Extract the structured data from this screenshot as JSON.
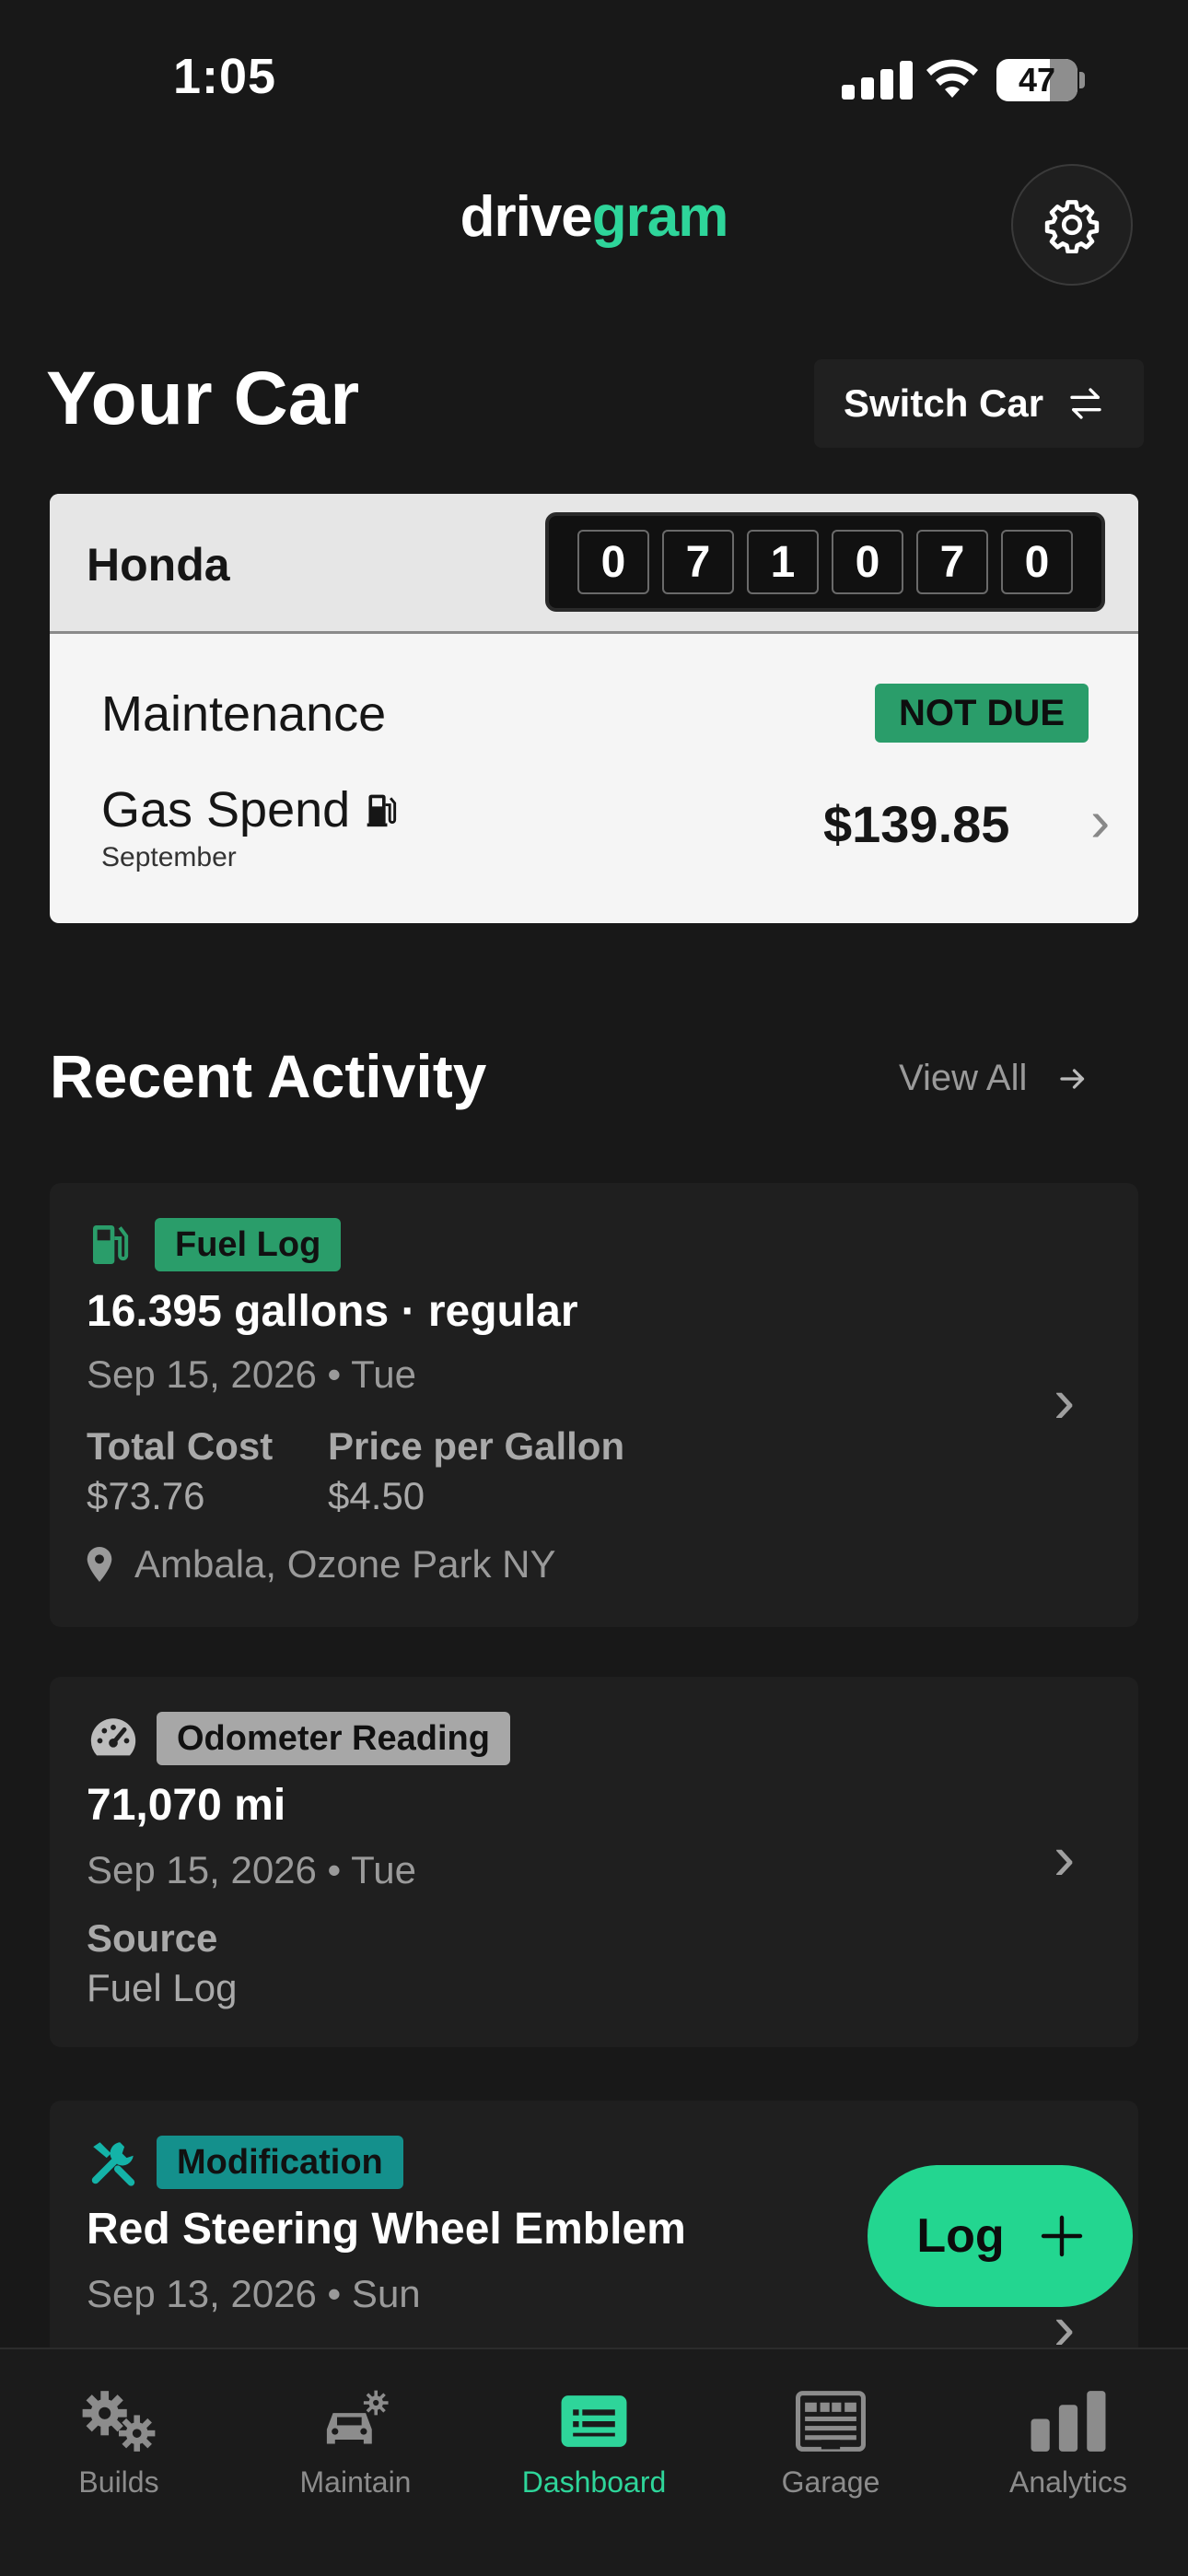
{
  "status_bar": {
    "time": "1:05",
    "battery": "47"
  },
  "header": {
    "logo_part1": "drive",
    "logo_part2": "gram"
  },
  "car_section": {
    "title": "Your Car",
    "switch_label": "Switch Car",
    "car_name": "Honda",
    "odometer_digits": [
      "0",
      "7",
      "1",
      "0",
      "7",
      "0"
    ],
    "maintenance_label": "Maintenance",
    "maintenance_status": "NOT DUE",
    "gas_label": "Gas Spend",
    "gas_month": "September",
    "gas_amount": "$139.85"
  },
  "recent": {
    "title": "Recent Activity",
    "view_all": "View All",
    "items": [
      {
        "tag": "Fuel Log",
        "title": "16.395 gallons · regular",
        "date": "Sep 15, 2026 • Tue",
        "total_cost_label": "Total Cost",
        "total_cost": "$73.76",
        "ppg_label": "Price per Gallon",
        "ppg": "$4.50",
        "location": "Ambala, Ozone Park NY"
      },
      {
        "tag": "Odometer Reading",
        "title": "71,070 mi",
        "date": "Sep 15, 2026 • Tue",
        "source_label": "Source",
        "source": "Fuel Log"
      },
      {
        "tag": "Modification",
        "title": "Red Steering Wheel Emblem",
        "date": "Sep 13, 2026 • Sun"
      }
    ]
  },
  "log_button": "Log",
  "tabbar": {
    "items": [
      "Builds",
      "Maintain",
      "Dashboard",
      "Garage",
      "Analytics"
    ],
    "active": "Dashboard"
  },
  "colors": {
    "accent": "#2ed59a",
    "background": "#181818",
    "card": "#1f1f1f",
    "fuel_tag": "#2a9d6a",
    "mod_tag": "#14908c"
  }
}
